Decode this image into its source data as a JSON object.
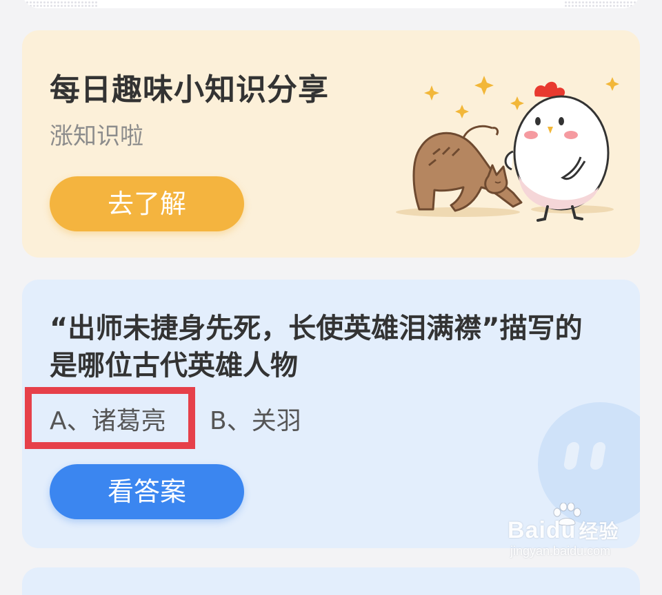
{
  "knowledge_card": {
    "title": "每日趣味小知识分享",
    "subtitle": "涨知识啦",
    "button_label": "去了解"
  },
  "quiz_card": {
    "question": "“出师未捷身先死，长使英雄泪满襟”描写的是哪位古代英雄人物",
    "options": [
      {
        "label": "A、诸葛亮",
        "highlighted": true
      },
      {
        "label": "B、关羽",
        "highlighted": false
      }
    ],
    "button_label": "看答案"
  },
  "watermark": {
    "logo_latin": "Baidu",
    "logo_cn": "经验",
    "url": "jingyan.baidu.com"
  },
  "colors": {
    "knowledge_bg": "#fcf0d9",
    "learn_button": "#f4b43f",
    "quiz_bg": "#e3eefc",
    "answer_button": "#3b86f0",
    "highlight_border": "#e6404a"
  }
}
